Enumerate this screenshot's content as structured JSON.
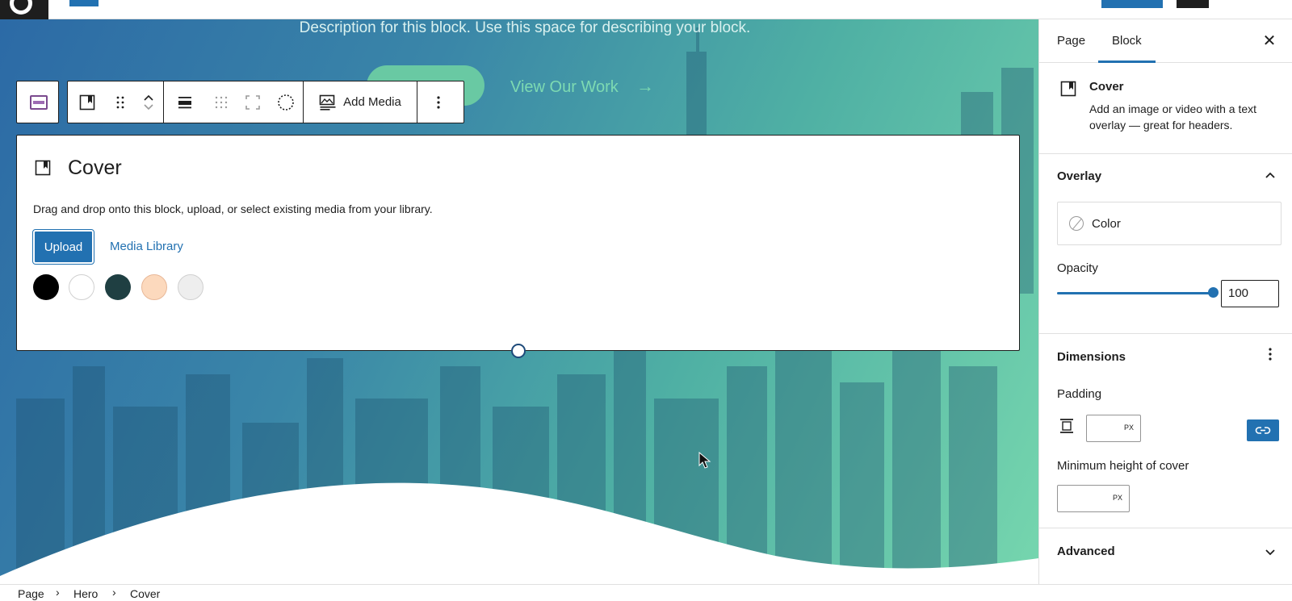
{
  "canvas": {
    "hero_description": "Description for this block. Use this space for describing your block.",
    "hero_link": "View Our Work"
  },
  "toolbar": {
    "add_media_label": "Add Media"
  },
  "placeholder": {
    "title": "Cover",
    "instructions": "Drag and drop onto this block, upload, or select existing media from your library.",
    "upload_label": "Upload",
    "media_library_label": "Media Library",
    "swatches": [
      "#000000",
      "#ffffff",
      "#1f3f42",
      "#fcd9bd",
      "#eeeeee"
    ]
  },
  "sidebar": {
    "tabs": [
      {
        "label": "Page"
      },
      {
        "label": "Block"
      }
    ],
    "active_tab": "Block",
    "block_card": {
      "title": "Cover",
      "description": "Add an image or video with a text overlay — great for headers."
    },
    "overlay": {
      "title": "Overlay",
      "color_label": "Color",
      "opacity_label": "Opacity",
      "opacity_value": "100"
    },
    "dimensions": {
      "title": "Dimensions",
      "padding_label": "Padding",
      "padding_unit": "PX",
      "min_height_label": "Minimum height of cover",
      "min_height_unit": "PX"
    },
    "advanced": {
      "title": "Advanced"
    }
  },
  "breadcrumb": [
    "Page",
    "Hero",
    "Cover"
  ],
  "colors": {
    "accent": "#2271b1",
    "canvas_gradient_start": "#2c6aa6",
    "canvas_gradient_end": "#76d6ae"
  }
}
